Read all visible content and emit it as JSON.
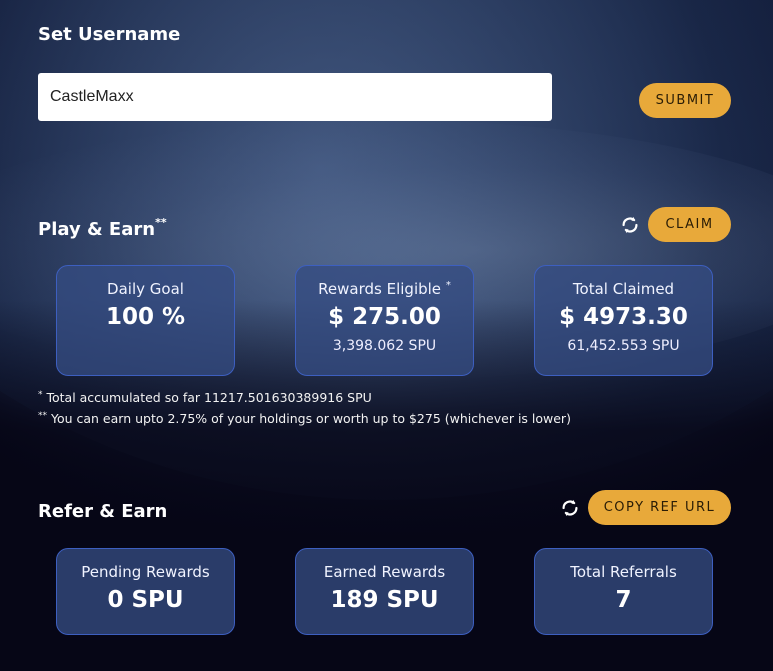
{
  "username": {
    "title": "Set Username",
    "input_value": "CastleMaxx",
    "submit_label": "SUBMIT"
  },
  "play_earn": {
    "title": "Play & Earn",
    "title_marker": "**",
    "claim_label": "CLAIM",
    "cards": [
      {
        "label": "Daily Goal",
        "marker": "",
        "value": "100 %",
        "sub": ""
      },
      {
        "label": "Rewards Eligible",
        "marker": "*",
        "value": "$ 275.00",
        "sub": "3,398.062 SPU"
      },
      {
        "label": "Total Claimed",
        "marker": "",
        "value": "$ 4973.30",
        "sub": "61,452.553 SPU"
      }
    ],
    "notes": [
      {
        "marker": "*",
        "text": "Total accumulated so far 11217.501630389916 SPU"
      },
      {
        "marker": "**",
        "text": "You can earn upto 2.75% of your holdings or worth up to $275 (whichever is lower)"
      }
    ]
  },
  "refer_earn": {
    "title": "Refer & Earn",
    "copy_label": "COPY REF URL",
    "cards": [
      {
        "label": "Pending Rewards",
        "value": "0 SPU"
      },
      {
        "label": "Earned Rewards",
        "value": "189 SPU"
      },
      {
        "label": "Total Referrals",
        "value": "7"
      }
    ]
  },
  "icons": {
    "refresh": "refresh-icon"
  },
  "colors": {
    "accent": "#e8a93a",
    "card_bg": "#344c82",
    "card_border": "#3d5fc0"
  }
}
